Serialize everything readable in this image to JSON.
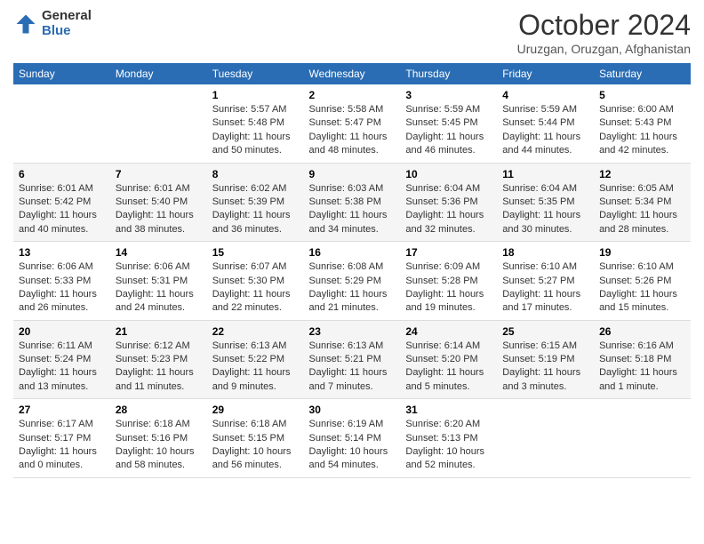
{
  "header": {
    "logo": {
      "general": "General",
      "blue": "Blue"
    },
    "title": "October 2024",
    "subtitle": "Uruzgan, Oruzgan, Afghanistan"
  },
  "days_of_week": [
    "Sunday",
    "Monday",
    "Tuesday",
    "Wednesday",
    "Thursday",
    "Friday",
    "Saturday"
  ],
  "weeks": [
    [
      {
        "day": "",
        "info": ""
      },
      {
        "day": "",
        "info": ""
      },
      {
        "day": "1",
        "info": "Sunrise: 5:57 AM\nSunset: 5:48 PM\nDaylight: 11 hours and 50 minutes."
      },
      {
        "day": "2",
        "info": "Sunrise: 5:58 AM\nSunset: 5:47 PM\nDaylight: 11 hours and 48 minutes."
      },
      {
        "day": "3",
        "info": "Sunrise: 5:59 AM\nSunset: 5:45 PM\nDaylight: 11 hours and 46 minutes."
      },
      {
        "day": "4",
        "info": "Sunrise: 5:59 AM\nSunset: 5:44 PM\nDaylight: 11 hours and 44 minutes."
      },
      {
        "day": "5",
        "info": "Sunrise: 6:00 AM\nSunset: 5:43 PM\nDaylight: 11 hours and 42 minutes."
      }
    ],
    [
      {
        "day": "6",
        "info": "Sunrise: 6:01 AM\nSunset: 5:42 PM\nDaylight: 11 hours and 40 minutes."
      },
      {
        "day": "7",
        "info": "Sunrise: 6:01 AM\nSunset: 5:40 PM\nDaylight: 11 hours and 38 minutes."
      },
      {
        "day": "8",
        "info": "Sunrise: 6:02 AM\nSunset: 5:39 PM\nDaylight: 11 hours and 36 minutes."
      },
      {
        "day": "9",
        "info": "Sunrise: 6:03 AM\nSunset: 5:38 PM\nDaylight: 11 hours and 34 minutes."
      },
      {
        "day": "10",
        "info": "Sunrise: 6:04 AM\nSunset: 5:36 PM\nDaylight: 11 hours and 32 minutes."
      },
      {
        "day": "11",
        "info": "Sunrise: 6:04 AM\nSunset: 5:35 PM\nDaylight: 11 hours and 30 minutes."
      },
      {
        "day": "12",
        "info": "Sunrise: 6:05 AM\nSunset: 5:34 PM\nDaylight: 11 hours and 28 minutes."
      }
    ],
    [
      {
        "day": "13",
        "info": "Sunrise: 6:06 AM\nSunset: 5:33 PM\nDaylight: 11 hours and 26 minutes."
      },
      {
        "day": "14",
        "info": "Sunrise: 6:06 AM\nSunset: 5:31 PM\nDaylight: 11 hours and 24 minutes."
      },
      {
        "day": "15",
        "info": "Sunrise: 6:07 AM\nSunset: 5:30 PM\nDaylight: 11 hours and 22 minutes."
      },
      {
        "day": "16",
        "info": "Sunrise: 6:08 AM\nSunset: 5:29 PM\nDaylight: 11 hours and 21 minutes."
      },
      {
        "day": "17",
        "info": "Sunrise: 6:09 AM\nSunset: 5:28 PM\nDaylight: 11 hours and 19 minutes."
      },
      {
        "day": "18",
        "info": "Sunrise: 6:10 AM\nSunset: 5:27 PM\nDaylight: 11 hours and 17 minutes."
      },
      {
        "day": "19",
        "info": "Sunrise: 6:10 AM\nSunset: 5:26 PM\nDaylight: 11 hours and 15 minutes."
      }
    ],
    [
      {
        "day": "20",
        "info": "Sunrise: 6:11 AM\nSunset: 5:24 PM\nDaylight: 11 hours and 13 minutes."
      },
      {
        "day": "21",
        "info": "Sunrise: 6:12 AM\nSunset: 5:23 PM\nDaylight: 11 hours and 11 minutes."
      },
      {
        "day": "22",
        "info": "Sunrise: 6:13 AM\nSunset: 5:22 PM\nDaylight: 11 hours and 9 minutes."
      },
      {
        "day": "23",
        "info": "Sunrise: 6:13 AM\nSunset: 5:21 PM\nDaylight: 11 hours and 7 minutes."
      },
      {
        "day": "24",
        "info": "Sunrise: 6:14 AM\nSunset: 5:20 PM\nDaylight: 11 hours and 5 minutes."
      },
      {
        "day": "25",
        "info": "Sunrise: 6:15 AM\nSunset: 5:19 PM\nDaylight: 11 hours and 3 minutes."
      },
      {
        "day": "26",
        "info": "Sunrise: 6:16 AM\nSunset: 5:18 PM\nDaylight: 11 hours and 1 minute."
      }
    ],
    [
      {
        "day": "27",
        "info": "Sunrise: 6:17 AM\nSunset: 5:17 PM\nDaylight: 11 hours and 0 minutes."
      },
      {
        "day": "28",
        "info": "Sunrise: 6:18 AM\nSunset: 5:16 PM\nDaylight: 10 hours and 58 minutes."
      },
      {
        "day": "29",
        "info": "Sunrise: 6:18 AM\nSunset: 5:15 PM\nDaylight: 10 hours and 56 minutes."
      },
      {
        "day": "30",
        "info": "Sunrise: 6:19 AM\nSunset: 5:14 PM\nDaylight: 10 hours and 54 minutes."
      },
      {
        "day": "31",
        "info": "Sunrise: 6:20 AM\nSunset: 5:13 PM\nDaylight: 10 hours and 52 minutes."
      },
      {
        "day": "",
        "info": ""
      },
      {
        "day": "",
        "info": ""
      }
    ]
  ]
}
